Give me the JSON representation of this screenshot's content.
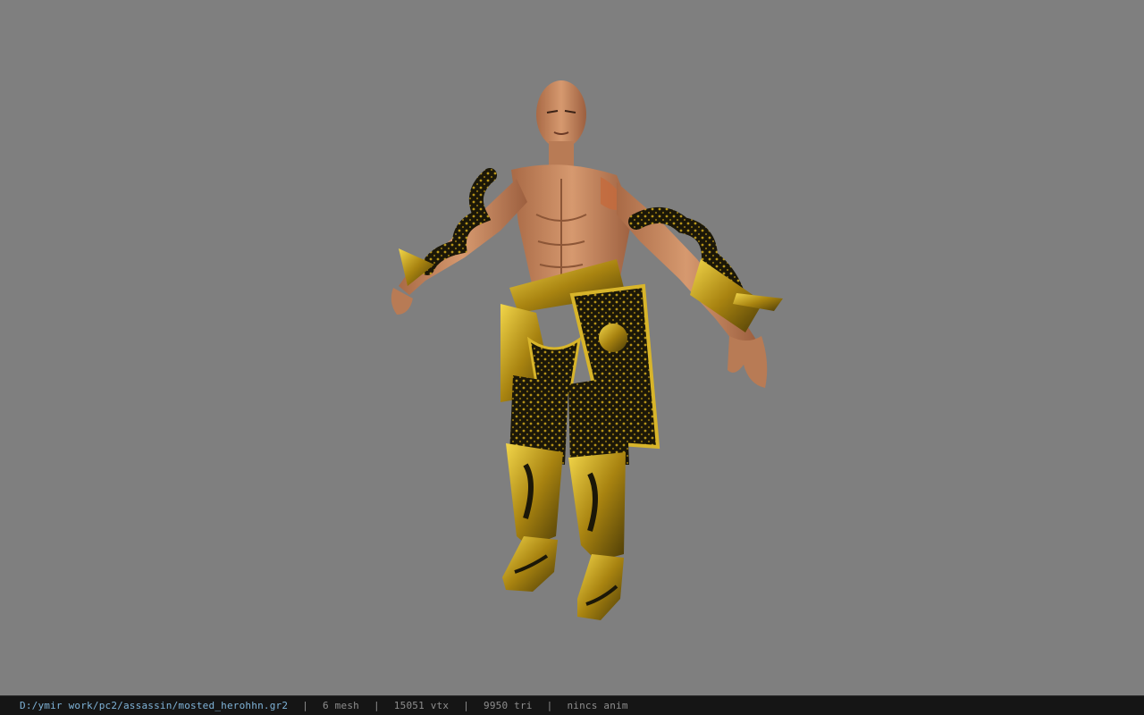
{
  "viewer": {
    "background_color": "#7f7f7f",
    "model_icon": "character-model"
  },
  "status": {
    "path": "D:/ymir work/pc2/assassin/mosted_herohhn.gr2",
    "separator": "|",
    "mesh": "6 mesh",
    "vertices": "15051 vtx",
    "triangles": "9950 tri",
    "anim": "nincs anim"
  },
  "colors": {
    "status_bar_bg": "#151515",
    "path_text": "#7fb3d8",
    "status_text": "#8e8e8e",
    "skin": "#c98a62",
    "gold": "#c9a319",
    "armor_dark": "#1b1708"
  }
}
